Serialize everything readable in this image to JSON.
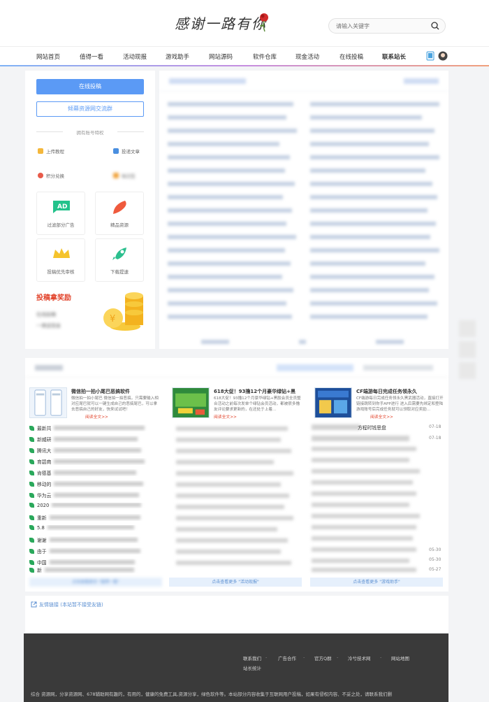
{
  "header": {
    "logo_text": "感谢一路有你",
    "search_placeholder": "请输入关键字"
  },
  "nav": {
    "items": [
      "网站首页",
      "值得一看",
      "活动现报",
      "游戏助手",
      "网站源码",
      "软件仓库",
      "现金活动",
      "在线投稿",
      "联系站长"
    ]
  },
  "sidebar": {
    "btn_submit": "在线投稿",
    "btn_group": "倾幕资源网交流群",
    "privilege_title": "拥有账号特权",
    "mini_items": [
      "上传教程",
      "投递文章",
      "积分兑换",
      "每日签"
    ],
    "tiles": [
      "过滤部分广告",
      "精品资源",
      "投稿优先审核",
      "下载提速"
    ],
    "reward_title": "投稿拿奖励",
    "reward_lines": [
      "在线投稿",
      "一律送现金"
    ]
  },
  "features": [
    {
      "title": "微信拍一拍小尾巴恶搞软件",
      "desc": "微信拍一拍小尾巴 微信拍一拍恶搞，只需要输入相对应尾巴就可以一键生成自己的恶搞尾巴，可以拿去恶搞自己的好友，快来试试吧！",
      "more": "阅读全文>>"
    },
    {
      "title": "618大促！93撸12个月豪华绿钻+黑",
      "desc": "618大促！93撸12个月豪华绿钻+黑胶会员全员整合活动之前每次发单个绿钻会员活动，都被很多撸友评论要求更新的，在还处于上着...",
      "more": "阅读全文>>"
    },
    {
      "title": "CF端游每日完成任务领永久",
      "desc": "CF端游每日完成任务领永久黑武器活动，直接打开链接跳转到你手APP进行 进入后需要先绑定和登陆游戏账号后完成任务就可以领取对应奖励...",
      "more": "阅读全文>>"
    }
  ],
  "articles_left": [
    "最新共",
    "新威研",
    "腾讯大",
    "育碧商",
    "肯德基",
    "移动的",
    "华为云",
    "2020",
    "重新",
    "5.8",
    "谢谢",
    "由于",
    "中国",
    "新",
    "V"
  ],
  "articles_right": [
    "方程时钱思盘",
    "",
    "",
    "",
    "",
    "",
    "",
    "",
    "",
    "",
    "",
    "",
    "",
    "",
    ""
  ],
  "dates_right": [
    "07-18",
    "07-18",
    "",
    "",
    "",
    "",
    "",
    "",
    "",
    "",
    "",
    "05-30",
    "05-30",
    "05-27"
  ],
  "more_bars": [
    "点击查看更多 \"值得一看\"",
    "点击查看更多 \"活动现报\"",
    "点击查看更多 \"游戏助手\""
  ],
  "links_title": "友情链接 (本站暂不接受友链)",
  "footer": {
    "links": [
      "联系我们",
      "广告合作",
      "官方Q群",
      "冷兮技术网",
      "网站地图",
      "站长统计"
    ],
    "separators": [
      "-",
      "-",
      "-",
      "-"
    ],
    "copy": "综合 资源网，分享资源网、678辅助网有趣的，有用的，健康的免费工具,资源分享，绿色软件等。本站部分内容收集于互联网用户投稿，如果有侵权内容、不妥之处，请联系我们删"
  }
}
